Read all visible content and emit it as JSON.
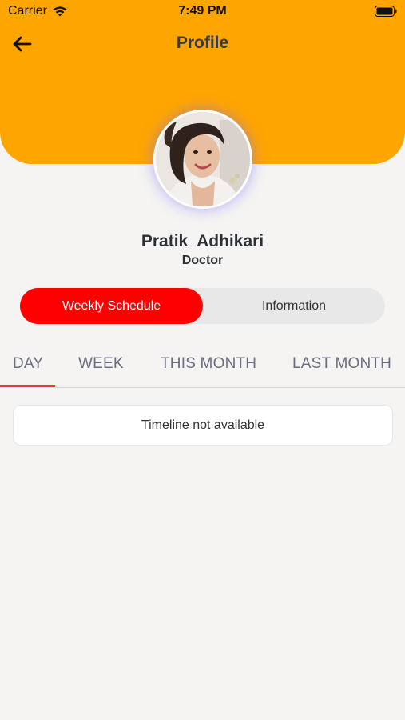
{
  "status_bar": {
    "carrier": "Carrier",
    "time": "7:49 PM"
  },
  "nav": {
    "title": "Profile"
  },
  "profile": {
    "name": "Pratik  Adhikari",
    "role": "Doctor"
  },
  "segments": {
    "active_label": "Weekly Schedule",
    "inactive_label": "Information",
    "active_color": "#ff0000"
  },
  "tabs": {
    "items": [
      "DAY",
      "WEEK",
      "THIS MONTH",
      "LAST MONTH"
    ],
    "selected": "DAY",
    "indicator_color": "#e53935"
  },
  "timeline": {
    "empty_text": "Timeline not available"
  },
  "colors": {
    "header": "#ffa500",
    "background": "#f5f4f2"
  }
}
